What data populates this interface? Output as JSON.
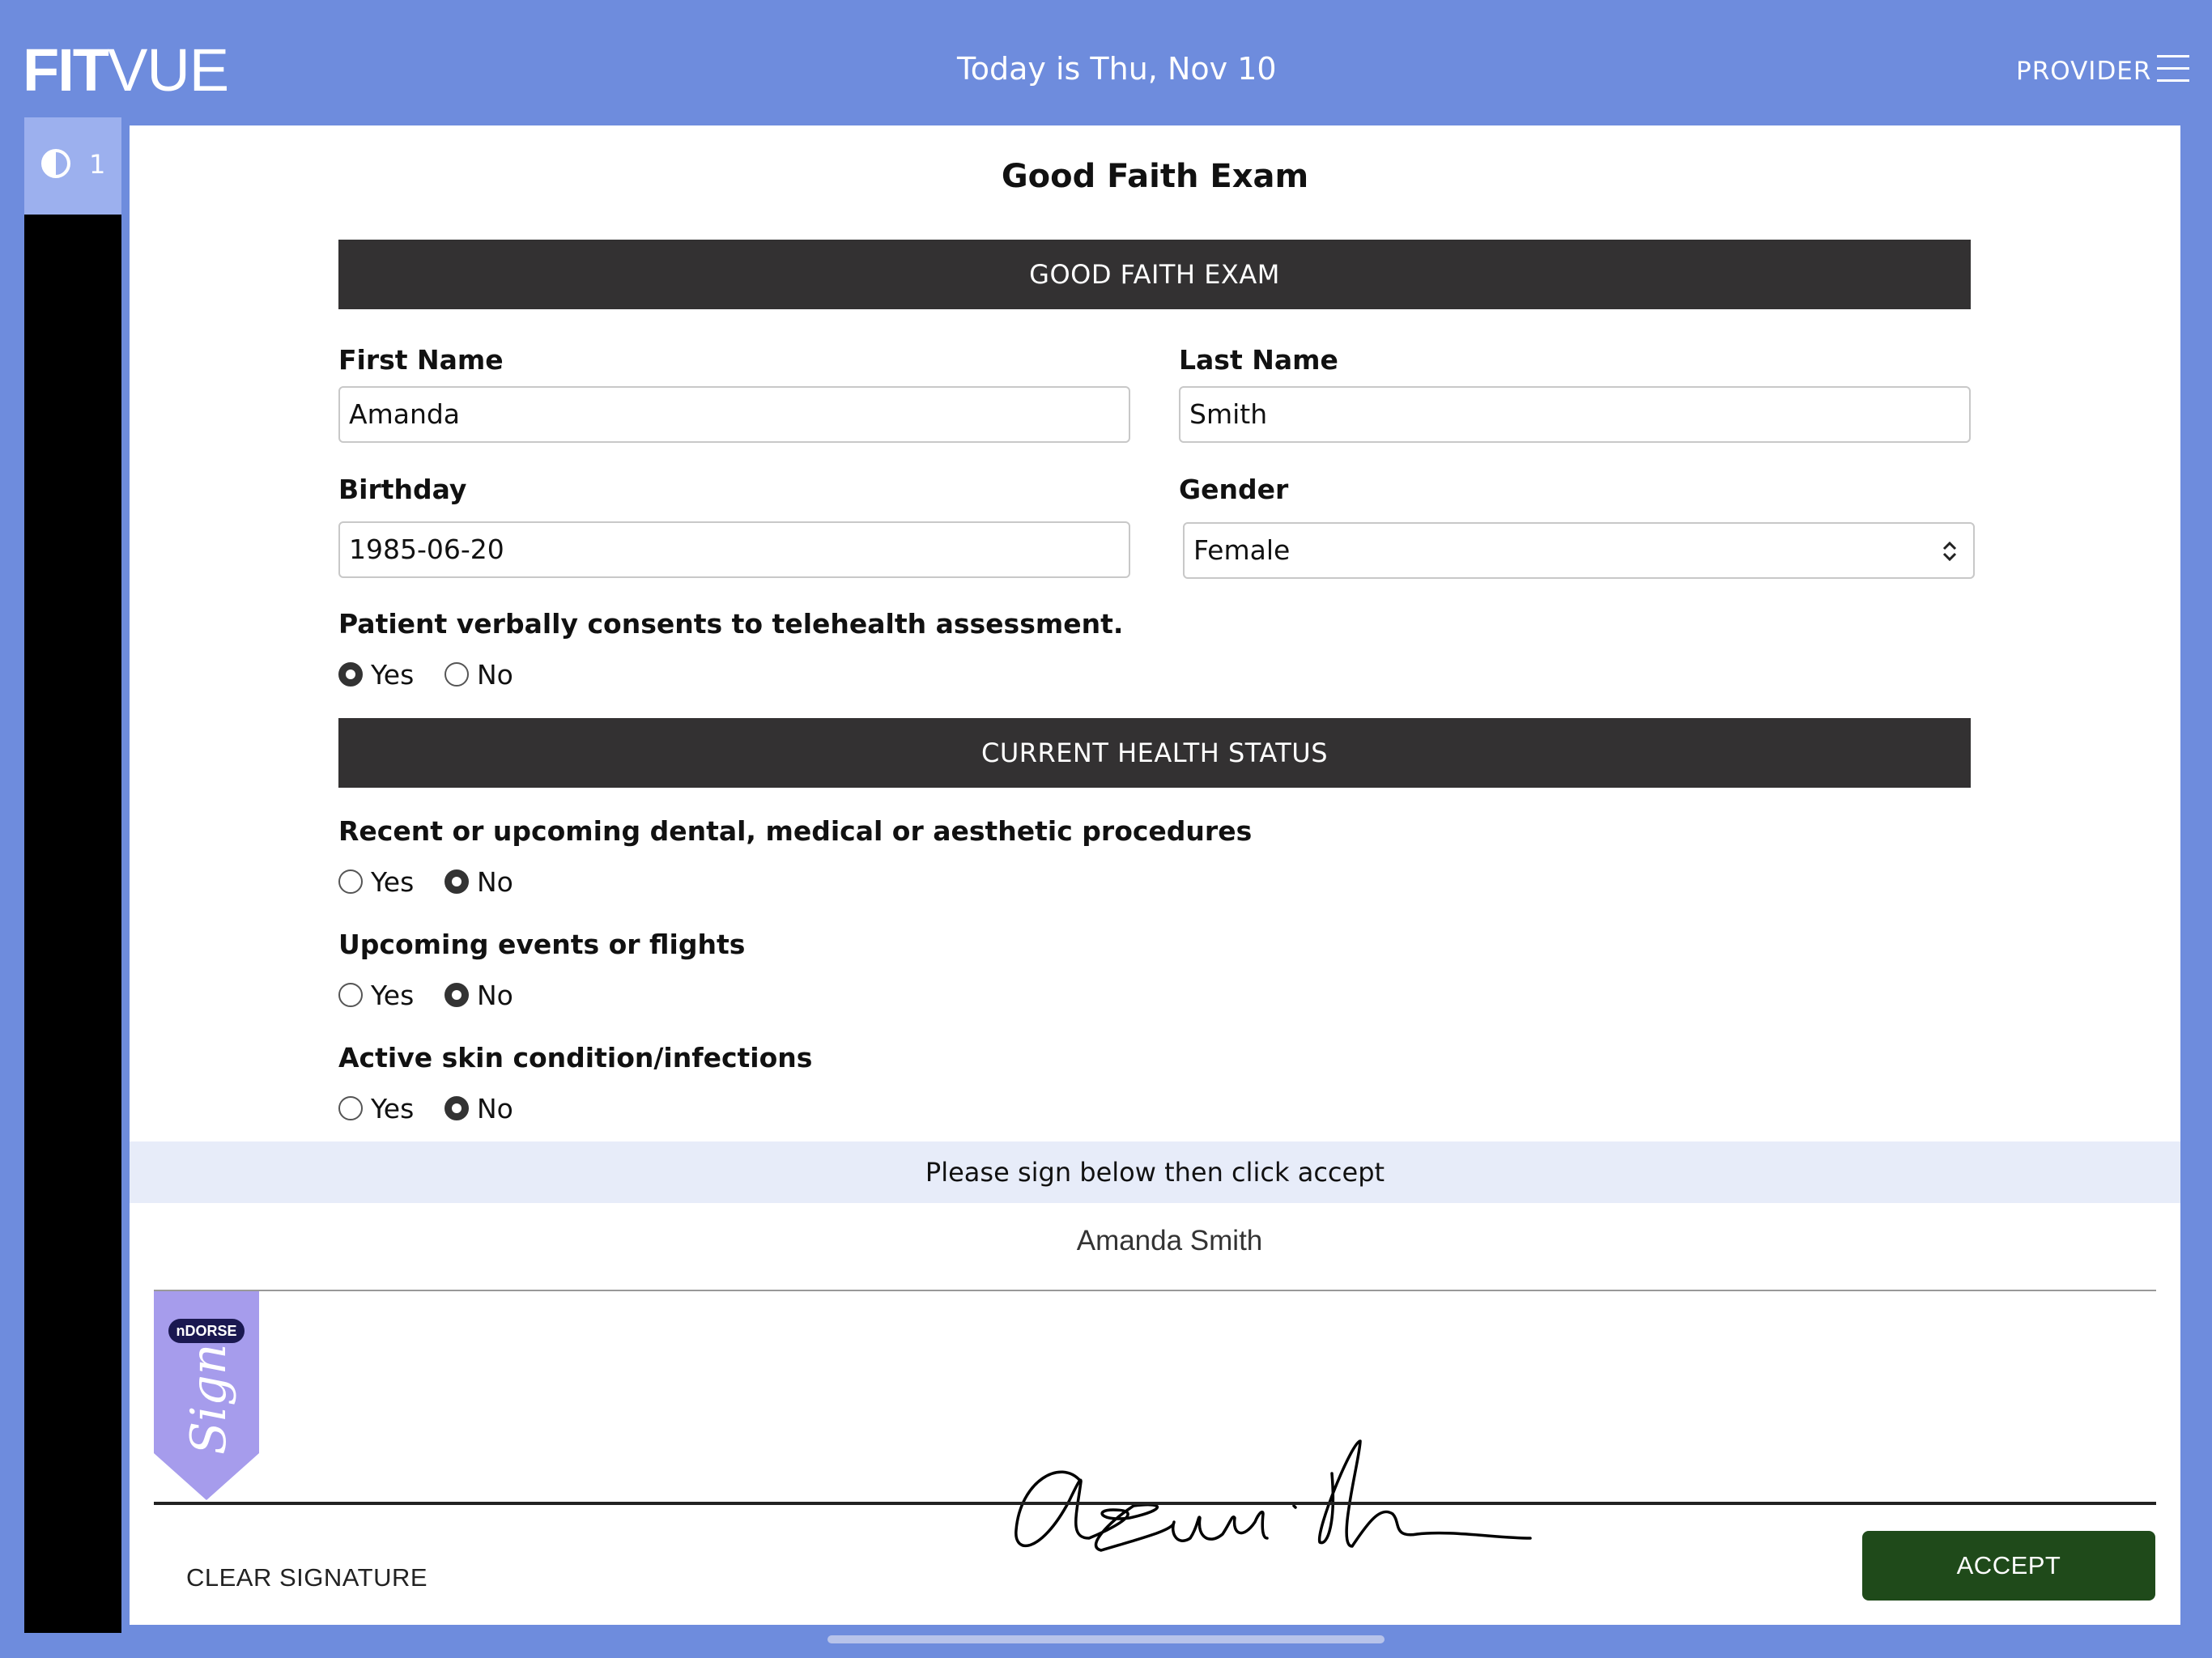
{
  "app": {
    "logo_bold": "FIT",
    "logo_light": "VUE",
    "date_text": "Today is Thu, Nov 10",
    "provider_label": "PROVIDER",
    "sidebar_count": "1",
    "accent_color": "#6e8cdd"
  },
  "form": {
    "page_title": "Good Faith Exam",
    "section_1_title": "GOOD FAITH EXAM",
    "first_name_label": "First Name",
    "first_name_value": "Amanda",
    "last_name_label": "Last Name",
    "last_name_value": "Smith",
    "birthday_label": "Birthday",
    "birthday_value": "1985-06-20",
    "gender_label": "Gender",
    "gender_value": "Female",
    "consent_question": "Patient verbally consents to telehealth assessment.",
    "consent_answer": "Yes",
    "section_2_title": "CURRENT HEALTH STATUS",
    "q_procedures": "Recent or upcoming dental, medical or aesthetic procedures",
    "q_procedures_answer": "No",
    "q_events": "Upcoming events or flights",
    "q_events_answer": "No",
    "q_skin": "Active skin condition/infections",
    "q_skin_answer": "No",
    "yes_label": "Yes",
    "no_label": "No"
  },
  "signature": {
    "instruction": "Please sign below then click accept",
    "signer_name": "Amanda Smith",
    "brand_badge": "nDORSE",
    "brand_tab_text": "Sign",
    "clear_label": "CLEAR SIGNATURE",
    "accept_label": "ACCEPT",
    "accept_color": "#1f4a1a"
  }
}
